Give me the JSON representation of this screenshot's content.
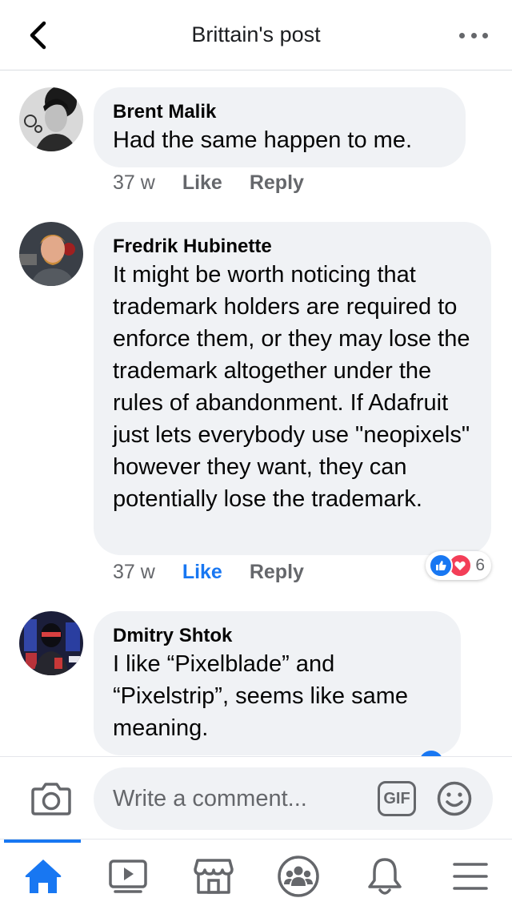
{
  "header": {
    "title": "Brittain's post",
    "back_icon": "chevron-left-icon",
    "more_icon": "more-horizontal-icon"
  },
  "comments": [
    {
      "author": "Brent Malik",
      "text": "Had the same happen to me.",
      "time": "37 w",
      "like_label": "Like",
      "reply_label": "Reply"
    },
    {
      "author": "Fredrik Hubinette",
      "text": "It might be worth noticing that trademark holders are required to enforce them, or they may lose the trademark altogether under the rules of abandonment. If Adafruit just lets everybody use \"neopixels\" however they want, they can potentially lose the trademark.",
      "time": "37 w",
      "like_label": "Like",
      "reply_label": "Reply",
      "liked": true,
      "reaction_count": "6",
      "reaction_icons": [
        "like-reaction-icon",
        "love-reaction-icon"
      ]
    },
    {
      "author": "Dmitry Shtok",
      "text": "I like “Pixelblade” and “Pixelstrip”, seems like same meaning."
    }
  ],
  "composer": {
    "placeholder": "Write a comment...",
    "gif_label": "GIF",
    "camera_icon": "camera-icon",
    "emoji_icon": "smiley-icon"
  },
  "tabs": [
    {
      "name": "home",
      "icon": "home-icon",
      "active": true
    },
    {
      "name": "watch",
      "icon": "video-icon"
    },
    {
      "name": "marketplace",
      "icon": "marketplace-icon"
    },
    {
      "name": "groups",
      "icon": "groups-icon"
    },
    {
      "name": "notifications",
      "icon": "bell-icon"
    },
    {
      "name": "menu",
      "icon": "hamburger-menu-icon"
    }
  ],
  "colors": {
    "accent": "#1877f2",
    "bubble": "#f0f2f5",
    "secondary_text": "#65676b",
    "love": "#f33e58"
  }
}
